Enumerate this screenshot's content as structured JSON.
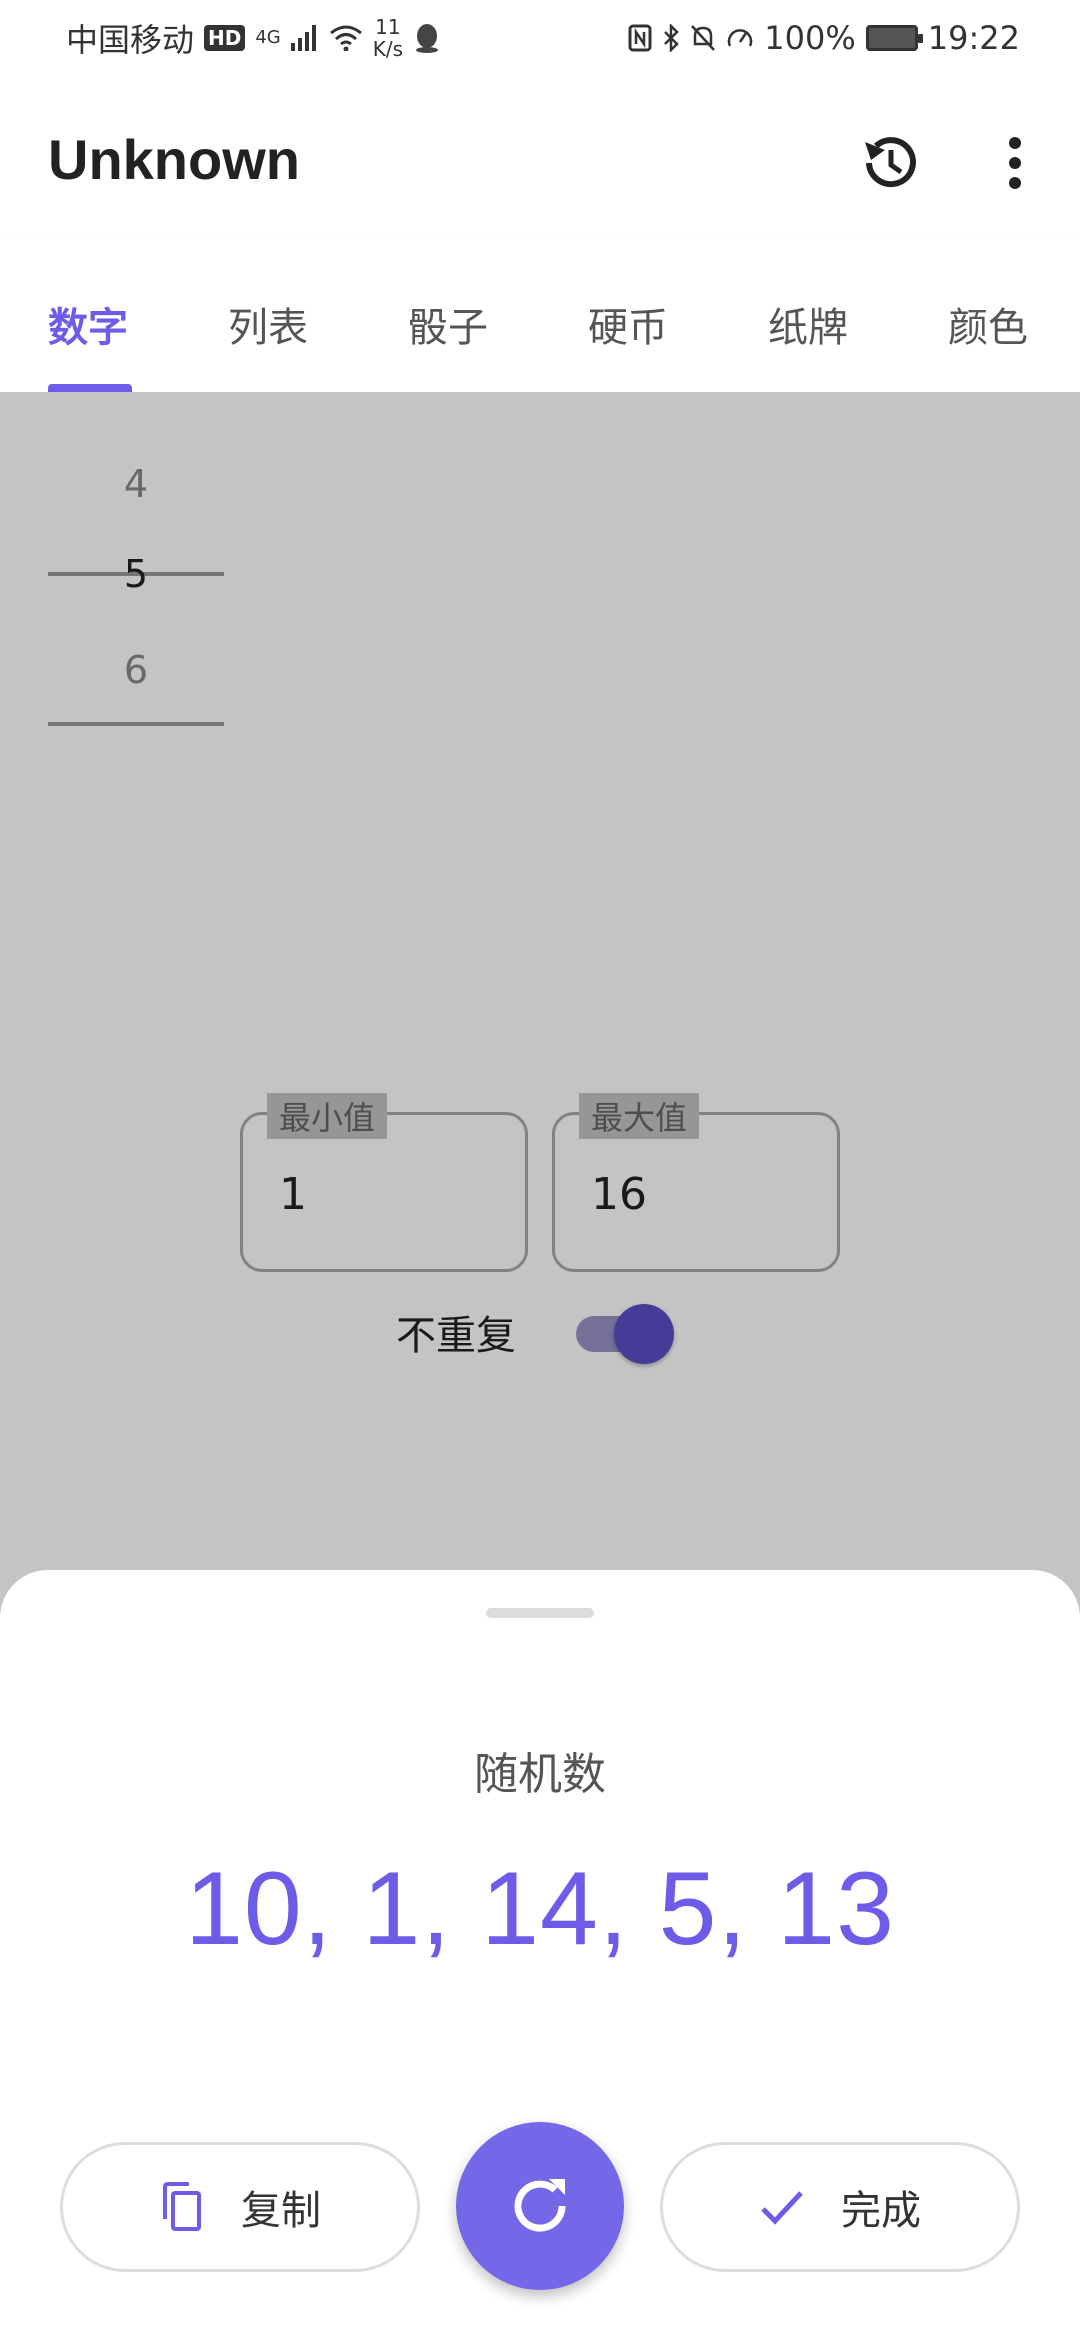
{
  "status_bar": {
    "carrier": "中国移动",
    "hd": "HD",
    "network": "4G",
    "speed_value": "11",
    "speed_unit": "K/s",
    "battery": "100%",
    "time": "19:22"
  },
  "app_bar": {
    "title": "Unknown"
  },
  "tabs": [
    {
      "label": "数字",
      "active": true
    },
    {
      "label": "列表",
      "active": false
    },
    {
      "label": "骰子",
      "active": false
    },
    {
      "label": "硬币",
      "active": false
    },
    {
      "label": "纸牌",
      "active": false
    },
    {
      "label": "颜色",
      "active": false
    }
  ],
  "picker": {
    "prev": "4",
    "current": "5",
    "next": "6"
  },
  "range": {
    "min_label": "最小值",
    "min_value": "1",
    "max_label": "最大值",
    "max_value": "16"
  },
  "no_repeat": {
    "label": "不重复",
    "enabled": true
  },
  "sheet": {
    "title": "随机数",
    "result": "10, 1, 14, 5, 13",
    "copy_label": "复制",
    "done_label": "完成"
  },
  "colors": {
    "accent": "#6c5ce7",
    "fab": "#7468e8",
    "switch_thumb": "#5a4fc6"
  }
}
